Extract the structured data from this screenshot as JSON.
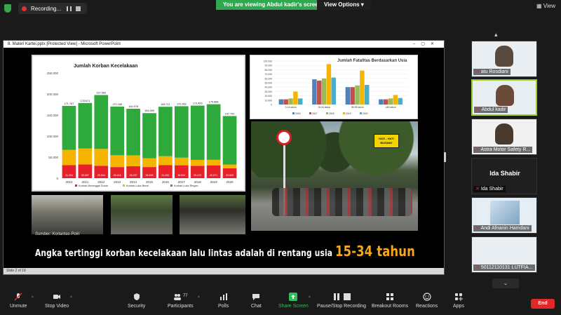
{
  "top": {
    "recording_label": "Recording...",
    "viewing_banner": "You are viewing Abdul kadir's screen",
    "view_options_label": "View Options",
    "view_label": "View"
  },
  "ppt": {
    "window_title": "8. Materi Kartei.pptx [Protected View] - Microsoft PowerPoint",
    "status": "Slide 2 of 18"
  },
  "slide": {
    "source": "Sumber: Korlantas Polri",
    "headline_main": "Angka tertinggi korban kecelakaan lalu lintas adalah di rentang usia",
    "headline_highlight": "15-34 tahun",
    "sign_text_line1": "HATI - HATI",
    "sign_text_line2": "BUSWAY"
  },
  "chart_data": [
    {
      "type": "bar",
      "title": "Jumlah Korban Kecelakaan",
      "categories": [
        "2010",
        "2011",
        "2012",
        "2013",
        "2014",
        "2015",
        "2016",
        "2017",
        "2018",
        "2019",
        "2020"
      ],
      "totals": [
        171767,
        178671,
        197560,
        170165,
        164978,
        154599,
        169711,
        170963,
        172400,
        175688,
        147700
      ],
      "total_labels": [
        "171.767",
        "178.671",
        "197.560",
        "170.165",
        "164.978",
        "154.599",
        "169.711",
        "170.963",
        "172.400",
        "175.688",
        "147.700"
      ],
      "series": [
        {
          "name": "Korban Meninggal Dunia",
          "color": "#e8202a",
          "values": [
            31234,
            32657,
            29544,
            26416,
            28297,
            26495,
            31262,
            30694,
            29472,
            30571,
            23529
          ],
          "labels": [
            "31.234",
            "32.657",
            "29.544",
            "26.416",
            "28.297",
            "26.495",
            "31.262",
            "30.694",
            "29.472",
            "30.571",
            "23.529"
          ]
        },
        {
          "name": "Korban Luka Berat",
          "color": "#f5b400",
          "values": [
            36000,
            38000,
            40000,
            28000,
            26000,
            21000,
            21000,
            18000,
            14000,
            13000,
            9000
          ]
        },
        {
          "name": "Korban Luka Ringan",
          "color": "#2eaa3c",
          "values": [
            104533,
            108014,
            128016,
            115749,
            110681,
            107104,
            117449,
            122269,
            128928,
            132117,
            115171
          ]
        }
      ],
      "yticks": [
        "250.000",
        "200.000",
        "150.000",
        "100.000",
        "50.000",
        "0"
      ],
      "ylim": [
        0,
        250000
      ]
    },
    {
      "type": "bar",
      "title": "Jumlah Fatalitas Berdasarkan Usia",
      "categories": [
        "0-14 tahun",
        "15-34 tahun",
        "35-59 tahun",
        "≥60 tahun"
      ],
      "series": [
        {
          "name": "2016",
          "color": "#4f81bd",
          "values": [
            12000,
            58000,
            40000,
            12000
          ]
        },
        {
          "name": "2017",
          "color": "#c0504d",
          "values": [
            12000,
            55000,
            40000,
            12000
          ]
        },
        {
          "name": "2018",
          "color": "#9bbb59",
          "values": [
            14000,
            60000,
            44000,
            14000
          ]
        },
        {
          "name": "2019",
          "color": "#f5b400",
          "values": [
            30000,
            93000,
            78000,
            22000
          ]
        },
        {
          "name": "2020",
          "color": "#4bacc6",
          "values": [
            14000,
            62000,
            45000,
            15000
          ]
        }
      ],
      "yticks": [
        "100.000",
        "90.000",
        "80.000",
        "70.000",
        "60.000",
        "50.000",
        "40.000",
        "30.000",
        "20.000",
        "10.000",
        "0"
      ],
      "ylim": [
        0,
        100000
      ]
    }
  ],
  "participants": [
    {
      "name": "atu Rosdiani"
    },
    {
      "name": "Abdul kadir"
    },
    {
      "name": "Astra Motor Safety R..."
    },
    {
      "name": "Ida Shabir",
      "big": "Ida Shabir"
    },
    {
      "name": "Andi Afnanin Hamdani"
    },
    {
      "name": "50112110131 LUTFIA..."
    }
  ],
  "toolbar": {
    "unmute": "Unmute",
    "stop_video": "Stop Video",
    "security": "Security",
    "participants": "Participants",
    "participants_count": "77",
    "polls": "Polls",
    "chat": "Chat",
    "share_screen": "Share Screen",
    "pause_recording": "Pause/Stop Recording",
    "breakout": "Breakout Rooms",
    "reactions": "Reactions",
    "apps": "Apps",
    "end": "End"
  },
  "colors": {
    "accent_green": "#2fa84f",
    "end_red": "#e02828",
    "highlight_orange": "#f5a623"
  }
}
